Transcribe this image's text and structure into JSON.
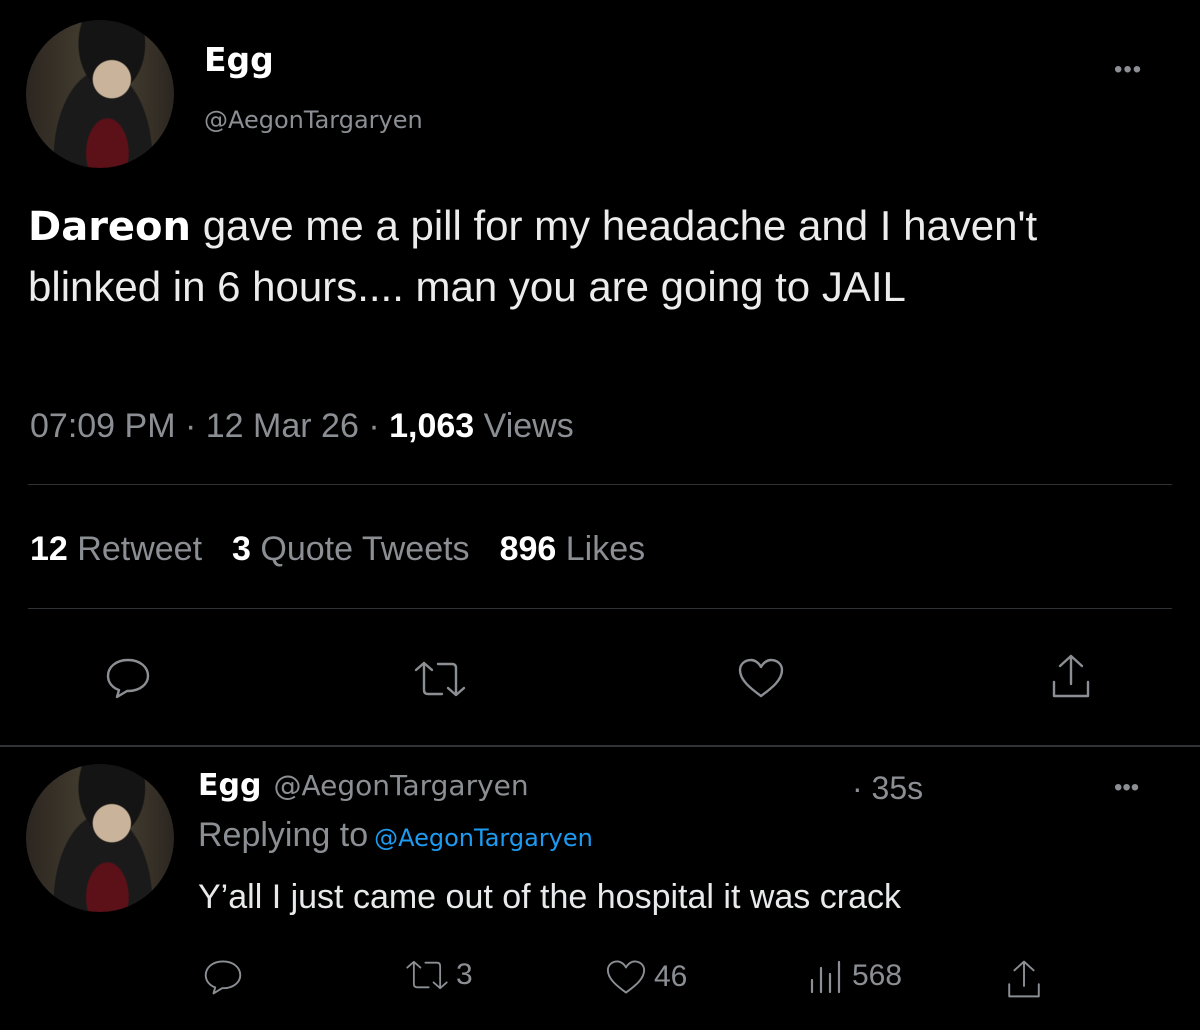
{
  "main_tweet": {
    "display_name": "Egg",
    "handle": "@AegonTargaryen",
    "more_label": "•••",
    "text_first_word": "Dareon",
    "text_rest": "gave me a pill for my headache and I haven't blinked in 6 hours.... man you are going to JAIL",
    "time": "07:09 PM",
    "date": "12 Mar 26",
    "views_count": "1,063",
    "views_label": "Views",
    "separator": "·",
    "stats": {
      "retweets_count": "12",
      "retweets_label": "Retweet",
      "quotes_count": "3",
      "quotes_label": "Quote Tweets",
      "likes_count": "896",
      "likes_label": "Likes"
    },
    "actions": [
      "reply-icon",
      "retweet-icon",
      "like-icon",
      "share-icon"
    ]
  },
  "reply": {
    "display_name": "Egg",
    "handle": "@AegonTargaryen",
    "time": "· 35s",
    "more_label": "•••",
    "replying_label": "Replying to",
    "replying_to": "@AegonTargaryen",
    "text": "Y’all I just came out of the hospital it was crack",
    "retweets": "3",
    "likes": "46",
    "views": "568"
  },
  "colors": {
    "background": "#000000",
    "text": "#e7e9ea",
    "muted": "#8b8f94",
    "link": "#1d9bf0",
    "divider": "#2f3336"
  }
}
